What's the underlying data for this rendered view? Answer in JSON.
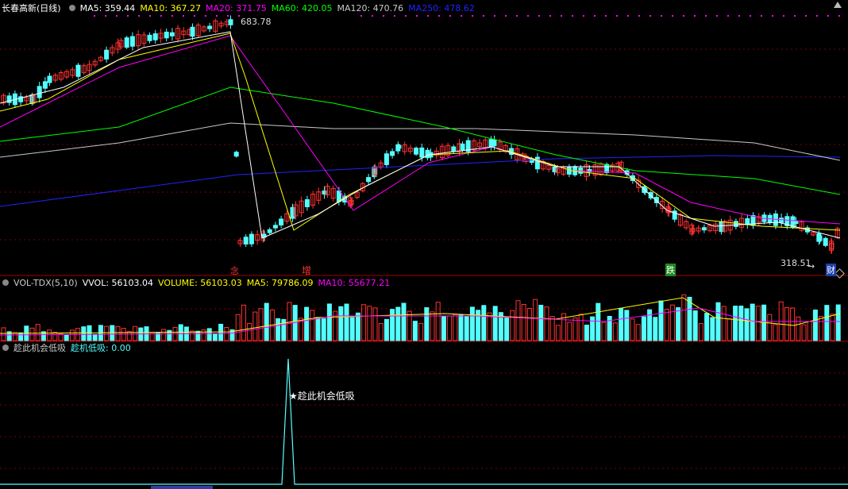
{
  "stock": {
    "name": "长春高新(日线)"
  },
  "ma_legend": [
    {
      "label": "MA5: 359.44",
      "color": "#ffffff"
    },
    {
      "label": "MA10: 367.27",
      "color": "#ffff00"
    },
    {
      "label": "MA20: 371.75",
      "color": "#ff00ff"
    },
    {
      "label": "MA60: 420.05",
      "color": "#00ff00"
    },
    {
      "label": "MA120: 470.76",
      "color": "#c8c8c8"
    },
    {
      "label": "MA250: 478.62",
      "color": "#2222ff"
    }
  ],
  "price": {
    "high_label": "683.78",
    "low_label": "318.51"
  },
  "event_tags": {
    "tag1": "念",
    "tag2": "增",
    "tag3": "跌",
    "tag4": "财"
  },
  "vol_legend": [
    {
      "label": "VOL-TDX(5,10)",
      "color": "#cccccc"
    },
    {
      "label": "VVOL: 56103.04",
      "color": "#ffffff"
    },
    {
      "label": "VOLUME: 56103.03",
      "color": "#ffff00"
    },
    {
      "label": "MA5: 79786.09",
      "color": "#ffff00"
    },
    {
      "label": "MA10: 55677.21",
      "color": "#ff00ff"
    }
  ],
  "ind_legend": [
    {
      "label": "趁此机会低吸",
      "color": "#cccccc"
    },
    {
      "label": "趁机低吸: 0.00",
      "color": "#54ffff"
    }
  ],
  "signal": {
    "label": "★趁此机会低吸"
  },
  "colors": {
    "up": "#ff3232",
    "down": "#54ffff",
    "grid": "#7a0000"
  }
}
